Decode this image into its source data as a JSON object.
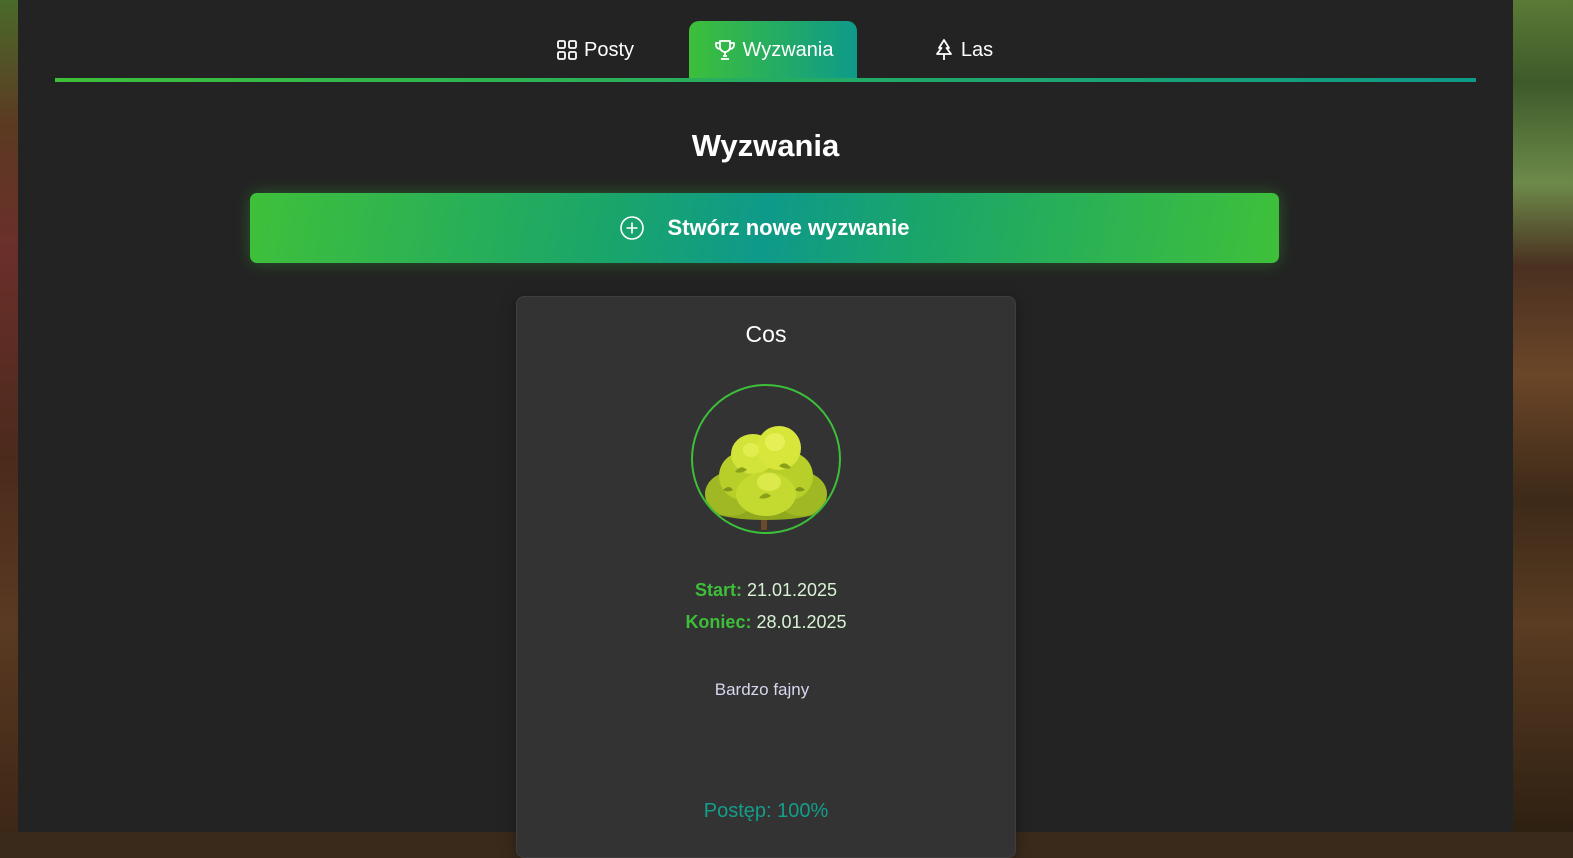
{
  "nav": {
    "tabs": [
      {
        "label": "Posty",
        "icon": "grid-icon",
        "active": false
      },
      {
        "label": "Wyzwania",
        "icon": "trophy-icon",
        "active": true
      },
      {
        "label": "Las",
        "icon": "tree-icon",
        "active": false
      }
    ]
  },
  "page": {
    "title": "Wyzwania",
    "create_button": {
      "label": "Stwórz nowe wyzwanie",
      "icon": "plus-circle-icon"
    }
  },
  "challenge": {
    "title": "Cos",
    "image": "bush-image",
    "start_label": "Start:",
    "start_date": "21.01.2025",
    "end_label": "Koniec:",
    "end_date": "28.01.2025",
    "description": "Bardzo fajny",
    "progress_text": "Postęp: 100%",
    "progress": 100
  },
  "colors": {
    "accent_green": "#3dbf3a",
    "accent_teal": "#0e9a8a",
    "panel": "#232323",
    "card": "#333333"
  }
}
